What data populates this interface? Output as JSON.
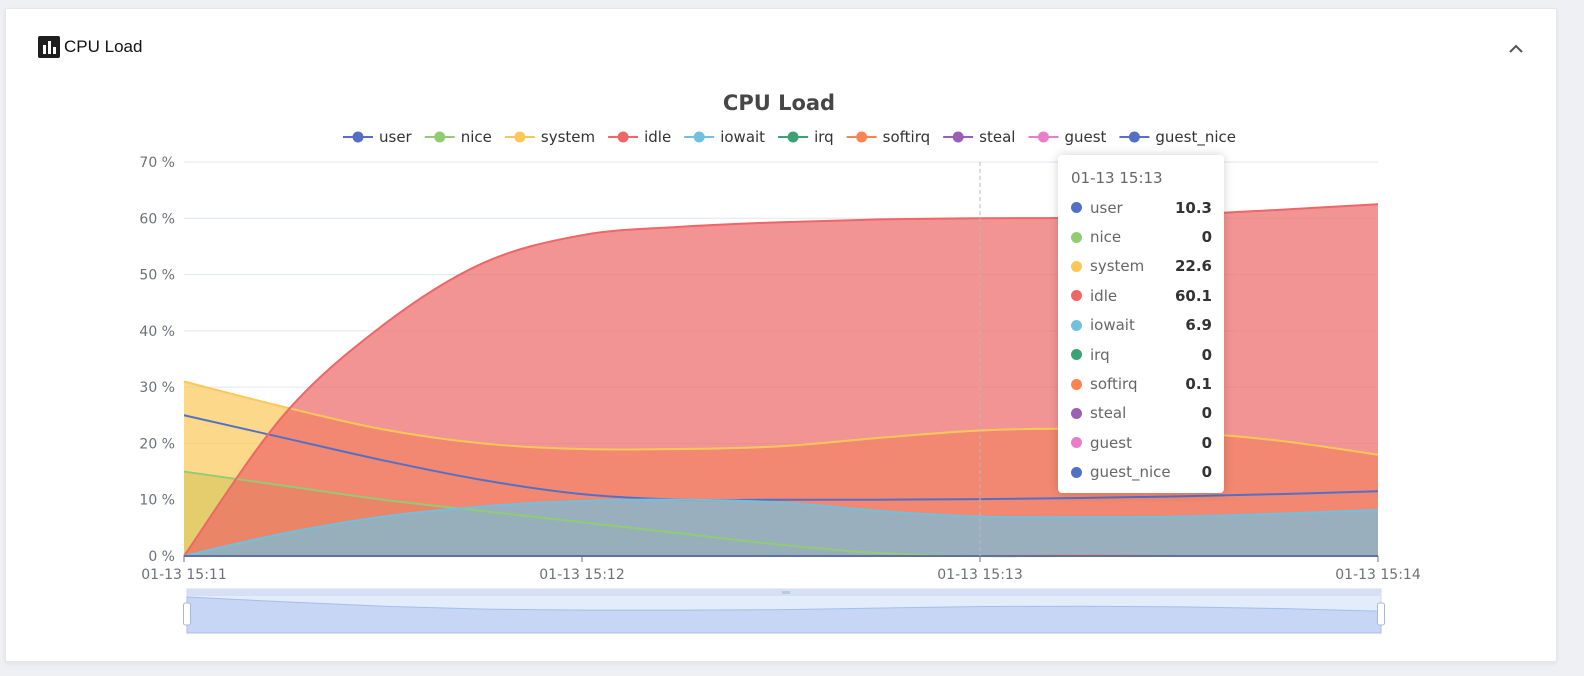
{
  "card": {
    "title": "CPU Load",
    "icon": "bar-chart-icon",
    "collapse_icon": "chevron-up-icon"
  },
  "chart_data": {
    "type": "area",
    "title": "CPU Load",
    "y_unit": "%",
    "ylim": [
      0,
      70
    ],
    "y_ticks": [
      0,
      10,
      20,
      30,
      40,
      50,
      60,
      70
    ],
    "x_ticks": [
      "01-13 15:11",
      "01-13 15:12",
      "01-13 15:13",
      "01-13 15:14"
    ],
    "x": [
      0,
      15,
      30,
      45,
      60,
      75,
      90,
      105,
      120,
      135,
      150,
      165,
      180
    ],
    "legend_position": "top-center",
    "grid": true,
    "series": [
      {
        "name": "user",
        "color": "#5470c6",
        "fill": false,
        "values": [
          25,
          21,
          17,
          13.5,
          11,
          10,
          10,
          10,
          10.1,
          10.3,
          10.6,
          11,
          11.5
        ]
      },
      {
        "name": "nice",
        "color": "#91cc75",
        "fill": true,
        "values": [
          15,
          12.5,
          10,
          8,
          6,
          4,
          2,
          0.5,
          0,
          0,
          0,
          0,
          0
        ]
      },
      {
        "name": "system",
        "color": "#fac858",
        "fill": true,
        "values": [
          31,
          26.5,
          22.5,
          20,
          19,
          19,
          19.5,
          21,
          22.3,
          22.6,
          22,
          20.5,
          18
        ]
      },
      {
        "name": "idle",
        "color": "#ee6666",
        "fill": true,
        "values": [
          0,
          25,
          41,
          52,
          57,
          58.5,
          59.3,
          59.8,
          60,
          60.1,
          60.6,
          61.5,
          62.5
        ]
      },
      {
        "name": "iowait",
        "color": "#73c0de",
        "fill": true,
        "values": [
          0,
          4,
          7,
          8.8,
          9.8,
          10,
          9.5,
          8,
          7,
          6.9,
          7,
          7.5,
          8.2
        ]
      },
      {
        "name": "irq",
        "color": "#3ba272",
        "fill": false,
        "values": [
          0,
          0,
          0,
          0,
          0,
          0,
          0,
          0,
          0,
          0,
          0,
          0,
          0
        ]
      },
      {
        "name": "softirq",
        "color": "#fc8452",
        "fill": false,
        "values": [
          0,
          0,
          0,
          0,
          0,
          0,
          0,
          0,
          0,
          0.1,
          0,
          0,
          0
        ]
      },
      {
        "name": "steal",
        "color": "#9a60b4",
        "fill": false,
        "values": [
          0,
          0,
          0,
          0,
          0,
          0,
          0,
          0,
          0,
          0,
          0,
          0,
          0
        ]
      },
      {
        "name": "guest",
        "color": "#ea7ccc",
        "fill": false,
        "values": [
          0,
          0,
          0,
          0,
          0,
          0,
          0,
          0,
          0,
          0,
          0,
          0,
          0
        ]
      },
      {
        "name": "guest_nice",
        "color": "#5470c6",
        "fill": false,
        "values": [
          0,
          0,
          0,
          0,
          0,
          0,
          0,
          0,
          0,
          0,
          0,
          0,
          0
        ]
      }
    ]
  },
  "tooltip": {
    "title": "01-13 15:13",
    "rows": [
      {
        "name": "user",
        "value": "10.3",
        "color": "#5470c6"
      },
      {
        "name": "nice",
        "value": "0",
        "color": "#91cc75"
      },
      {
        "name": "system",
        "value": "22.6",
        "color": "#fac858"
      },
      {
        "name": "idle",
        "value": "60.1",
        "color": "#ee6666"
      },
      {
        "name": "iowait",
        "value": "6.9",
        "color": "#73c0de"
      },
      {
        "name": "irq",
        "value": "0",
        "color": "#3ba272"
      },
      {
        "name": "softirq",
        "value": "0.1",
        "color": "#fc8452"
      },
      {
        "name": "steal",
        "value": "0",
        "color": "#9a60b4"
      },
      {
        "name": "guest",
        "value": "0",
        "color": "#ea7ccc"
      },
      {
        "name": "guest_nice",
        "value": "0",
        "color": "#5470c6"
      }
    ]
  },
  "zoom": {
    "start_percent": 0,
    "end_percent": 100
  }
}
